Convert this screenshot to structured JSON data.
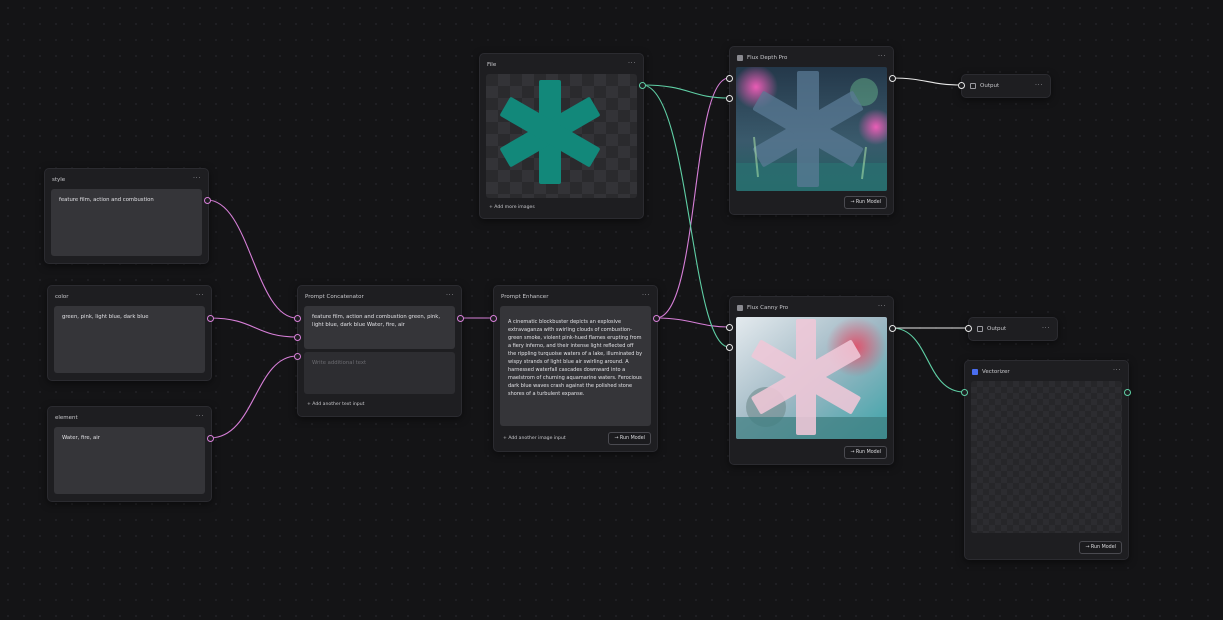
{
  "colors": {
    "canvas": "#141416",
    "node": "#1e1e21",
    "wire_pink": "#d77fd8",
    "wire_teal": "#5fcfa5",
    "wire_white": "#e8e8e8",
    "asterisk_teal": "#12887a"
  },
  "nodes": {
    "style": {
      "title": "style",
      "text": "feature film, action and combustion"
    },
    "color": {
      "title": "color",
      "text": "green, pink, light blue, dark blue"
    },
    "element": {
      "title": "element",
      "text": "Water, fire, air"
    },
    "concat": {
      "title": "Prompt Concatenator",
      "text": "feature film, action and combustion green, pink, light blue, dark blue Water, fire, air",
      "placeholder": "Write additional text",
      "add_label": "+ Add another text input"
    },
    "enhancer": {
      "title": "Prompt Enhancer",
      "text": "A cinematic blockbuster depicts an explosive extravaganza with swirling clouds of combustion-green smoke, violent pink-hued flames erupting from a fiery inferno, and their intense light reflected off the rippling turquoise waters of a lake, illuminated by wispy strands of light blue air swirling around. A harnessed waterfall cascades downward into a maelstrom of churning aquamarine waters. Ferocious dark blue waves crash against the polished stone shores of a turbulent expanse.",
      "add_label": "Add another image input",
      "run_label": "→ Run Model"
    },
    "file": {
      "title": "File",
      "add_label": "+ Add more images"
    },
    "depth": {
      "title": "Flux Depth Pro",
      "run_label": "→ Run Model"
    },
    "canny": {
      "title": "Flux Canny Pro",
      "run_label": "→ Run Model"
    },
    "output1": {
      "title": "Output"
    },
    "output2": {
      "title": "Output"
    },
    "vectorizer": {
      "title": "Vectorizer",
      "run_label": "→ Run Model"
    }
  },
  "menu_glyph": "···"
}
